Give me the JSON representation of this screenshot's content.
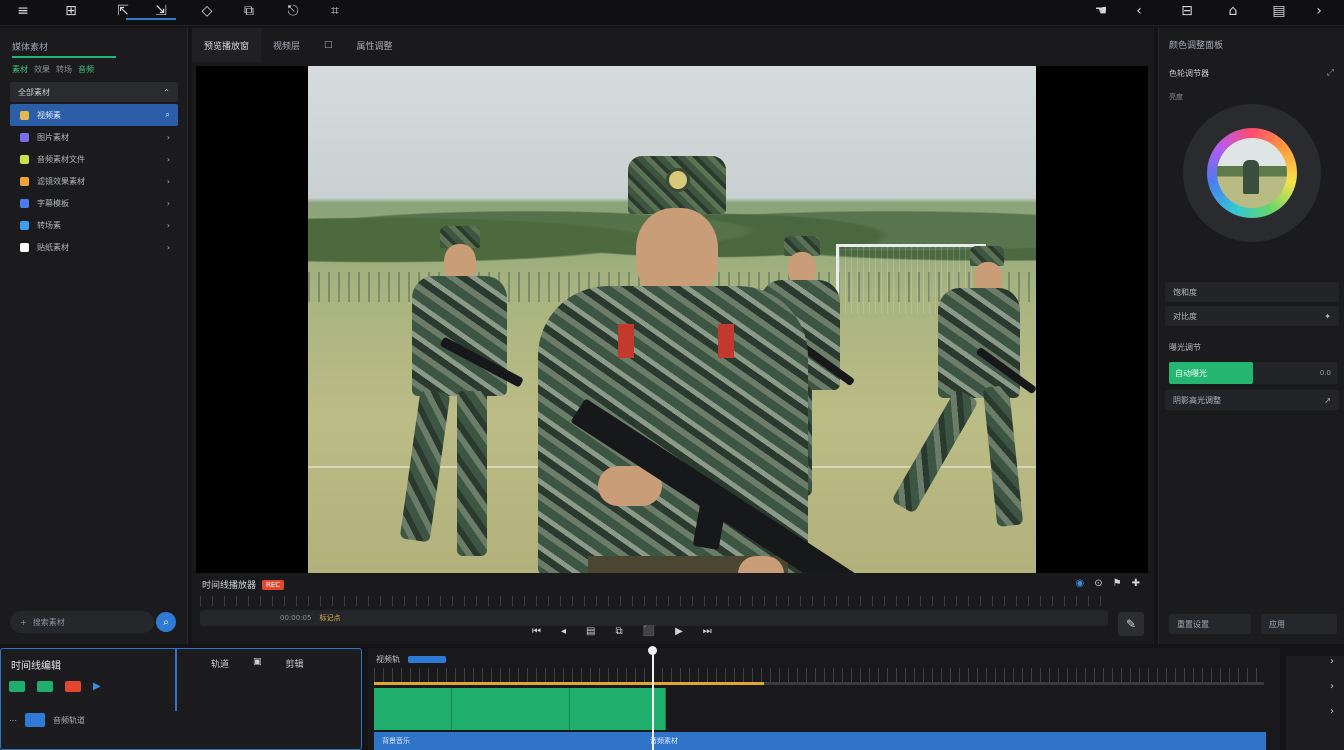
{
  "toolbar": {
    "icons": [
      {
        "name": "menu-icon",
        "glyph": "≡"
      },
      {
        "name": "layout-icon",
        "glyph": "⊞"
      },
      {
        "name": "import-icon",
        "glyph": "⇱"
      },
      {
        "name": "edit-icon",
        "glyph": "⇲"
      },
      {
        "name": "crop-icon",
        "glyph": "◇"
      },
      {
        "name": "transform-icon",
        "glyph": "⧉"
      },
      {
        "name": "export-icon",
        "glyph": "⎋"
      },
      {
        "name": "text-icon",
        "glyph": "⌗"
      }
    ],
    "right_icons": [
      {
        "name": "hand-icon",
        "glyph": "☚"
      },
      {
        "name": "back-icon",
        "glyph": "‹"
      },
      {
        "name": "grid-icon",
        "glyph": "⊟"
      },
      {
        "name": "home-icon",
        "glyph": "⌂"
      },
      {
        "name": "panel-icon",
        "glyph": "▤"
      },
      {
        "name": "forward-icon",
        "glyph": "›"
      }
    ]
  },
  "left_panel": {
    "title": "媒体素材",
    "subtabs": [
      "素材",
      "效果",
      "转场",
      "音频"
    ],
    "header": "全部素材",
    "items": [
      {
        "label": "视频素",
        "color": "#e5b84a",
        "selected": true
      },
      {
        "label": "图片素材",
        "color": "#7a6cf0",
        "selected": false
      },
      {
        "label": "音频素材文件",
        "color": "#c9e04b",
        "selected": false
      },
      {
        "label": "滤镜效果素材",
        "color": "#f0a23a",
        "selected": false
      },
      {
        "label": "字幕模板",
        "color": "#4a7cf0",
        "selected": false
      },
      {
        "label": "转场素",
        "color": "#3a9ff0",
        "selected": false
      },
      {
        "label": "贴纸素材",
        "color": "#ffffff",
        "selected": false
      }
    ],
    "search_placeholder": "搜索素材"
  },
  "center": {
    "tabs": [
      "预览播放窗",
      "视频层",
      "□",
      "属性调整"
    ],
    "transport_label": "时间线播放器",
    "badge": "REC",
    "scrub_text": "00:00:05",
    "scrub_marker": "标记点",
    "right_icons": [
      "◉",
      "⊙",
      "⚑",
      "✚"
    ],
    "controls": [
      "⏮",
      "◂",
      "▤",
      "⧉",
      "⬛",
      "▶",
      "⏭"
    ],
    "wand_glyph": "✎"
  },
  "right_panel": {
    "title": "颜色调整面板",
    "subtitle": "色轮调节器",
    "subtitle2": "亮度",
    "row1": "饱和度",
    "row2": "对比度",
    "section": "曝光调节",
    "green_label": "自动曝光",
    "green_value": "0.0",
    "row3": "阴影高光调整",
    "footer_left": "重置设置",
    "footer_right": "应用"
  },
  "bottom": {
    "title": "时间线编辑",
    "mid_labels": [
      "轨道",
      "▣",
      "剪辑"
    ],
    "row_label": "音频轨道",
    "timeline_label": "视频轨",
    "clip_label": "背景音乐",
    "clip_label2": "音频素材"
  }
}
